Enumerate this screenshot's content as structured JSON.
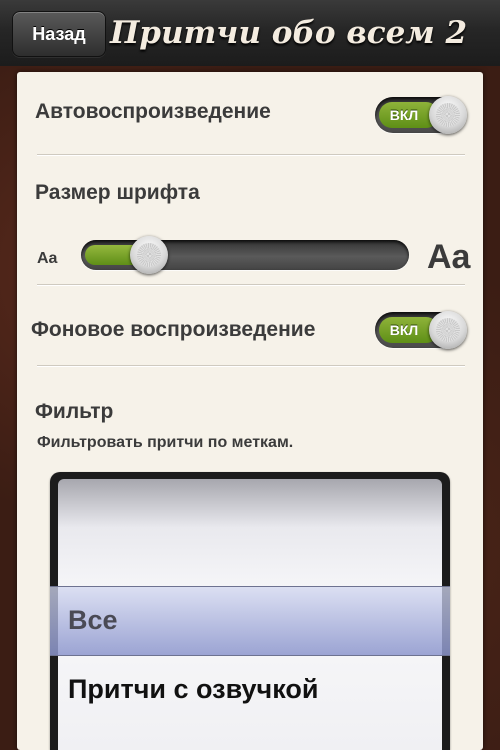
{
  "header": {
    "back_label": "Назад",
    "title": "Притчи обо всем 2"
  },
  "settings": {
    "autoplay": {
      "label": "Автовоспроизведение",
      "toggle_label": "ВКЛ",
      "on": true
    },
    "font_size": {
      "label": "Размер шрифта",
      "small_label": "Aa",
      "large_label": "Aa",
      "value": 0.2
    },
    "background_playback": {
      "label": "Фоновое воспроизведение",
      "toggle_label": "ВКЛ",
      "on": true
    },
    "filter": {
      "label": "Фильтр",
      "description": "Фильтровать притчи по меткам.",
      "options": [
        "Все",
        "Притчи с озвучкой"
      ],
      "selected": "Все"
    }
  },
  "colors": {
    "accent_green": "#7aa62a",
    "panel": "#f6f2e9"
  }
}
